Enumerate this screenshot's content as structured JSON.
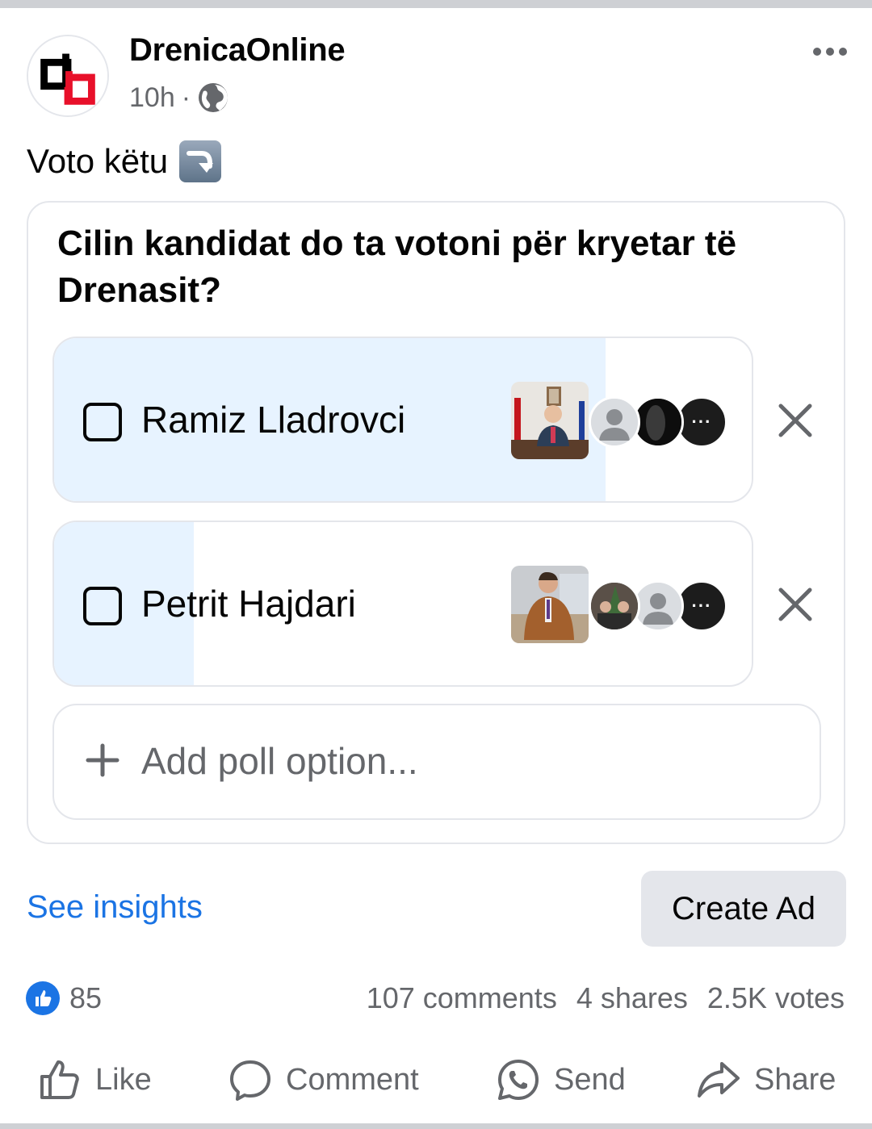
{
  "post": {
    "page_name": "DrenicaOnline",
    "time": "10h",
    "separator": "·",
    "text": "Voto këtu"
  },
  "icons": {
    "avatar": "drenica-logo",
    "privacy": "globe-icon",
    "more": "more-dots-icon",
    "emoji": "right-arrow-curving-down-emoji"
  },
  "poll": {
    "question": "Cilin kandidat do ta votoni për kryetar të Drenasit?",
    "options": [
      {
        "label": "Ramiz Lladrovci",
        "vote_share": 0.79,
        "more_label": "···"
      },
      {
        "label": "Petrit Hajdari",
        "vote_share": 0.2,
        "more_label": "···"
      }
    ],
    "add_option_label": "Add poll option..."
  },
  "actions": {
    "see_insights": "See insights",
    "create_ad": "Create Ad"
  },
  "stats": {
    "likes": "85",
    "comments": "107 comments",
    "shares": "4 shares",
    "votes": "2.5K votes"
  },
  "buttons": {
    "like": "Like",
    "comment": "Comment",
    "send": "Send",
    "share": "Share"
  },
  "colors": {
    "accent": "#1b74e4",
    "poll_fill": "#e7f3ff",
    "secondary_text": "#65676b"
  }
}
